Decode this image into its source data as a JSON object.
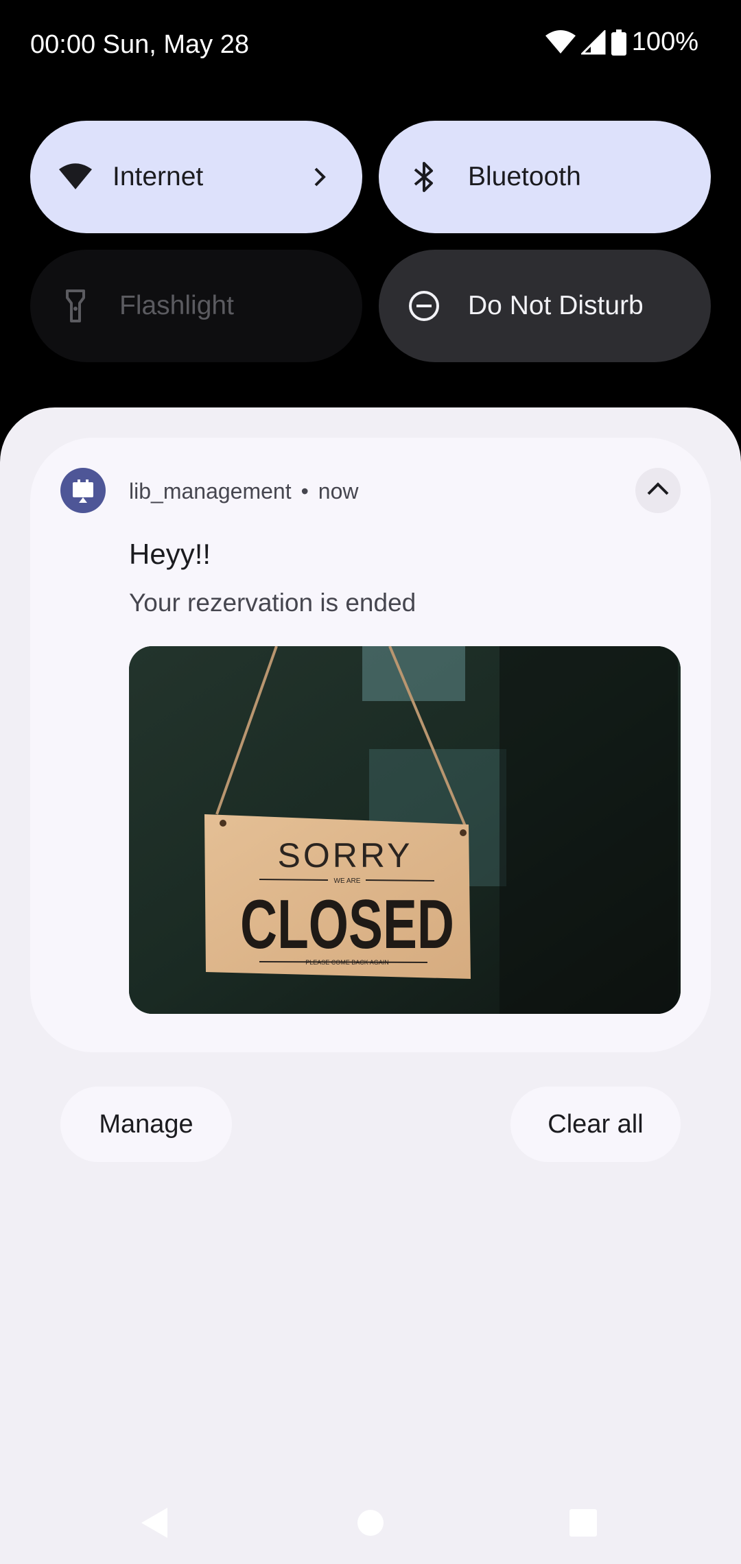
{
  "status_bar": {
    "datetime": "00:00 Sun, May 28",
    "battery": "100%",
    "icons": [
      "wifi-icon",
      "cell-signal-icon",
      "battery-icon"
    ]
  },
  "quick_tiles": [
    {
      "label": "Internet",
      "icon": "wifi-icon",
      "state": "on",
      "has_chevron": true
    },
    {
      "label": "Bluetooth",
      "icon": "bluetooth-icon",
      "state": "on"
    },
    {
      "label": "Flashlight",
      "icon": "flashlight-icon",
      "state": "unavailable"
    },
    {
      "label": "Do Not Disturb",
      "icon": "do-not-disturb-icon",
      "state": "off"
    }
  ],
  "notification": {
    "app_name": "lib_management",
    "separator": "•",
    "time": "now",
    "title": "Heyy!!",
    "text": "Your rezervation is ended",
    "image": {
      "line1": "SORRY",
      "line2": "WE ARE",
      "line3": "CLOSED",
      "line4": "PLEASE COME BACK AGAIN"
    }
  },
  "actions": {
    "manage": "Manage",
    "clear_all": "Clear all"
  },
  "colors": {
    "tile_active": "#dde1fb",
    "tile_dark": "#2d2d31",
    "shade_bg": "#f1eff5",
    "app_icon": "#4e5697"
  }
}
